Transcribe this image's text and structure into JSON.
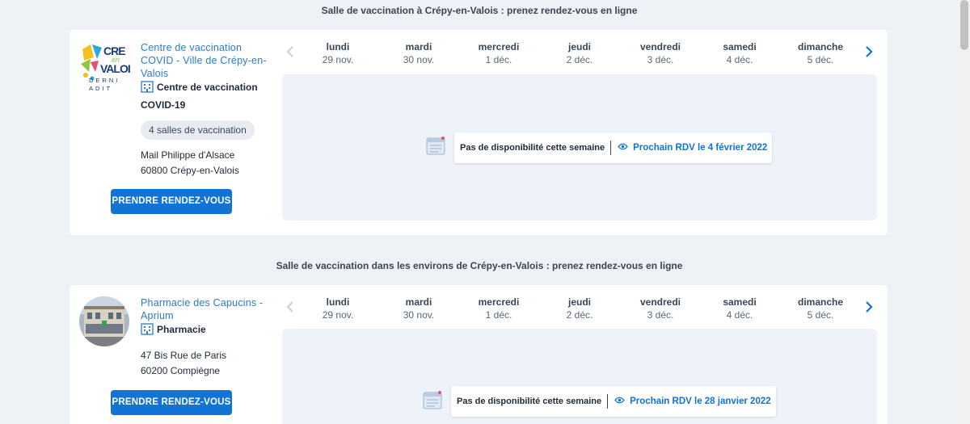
{
  "section1": {
    "title": "Salle de vaccination à Crépy-en-Valois : prenez rendez-vous en ligne"
  },
  "section2": {
    "title": "Salle de vaccination dans les environs de Crépy-en-Valois : prenez rendez-vous en ligne"
  },
  "days": [
    {
      "name": "lundi",
      "date": "29 nov."
    },
    {
      "name": "mardi",
      "date": "30 nov."
    },
    {
      "name": "mercredi",
      "date": "1 déc."
    },
    {
      "name": "jeudi",
      "date": "2 déc."
    },
    {
      "name": "vendredi",
      "date": "3 déc."
    },
    {
      "name": "samedi",
      "date": "4 déc."
    },
    {
      "name": "dimanche",
      "date": "5 déc."
    }
  ],
  "centers": [
    {
      "name": "Centre de vaccination COVID - Ville de Crépy-en-Valois",
      "type": "Centre de vaccination COVID-19",
      "rooms": "4 salles de vaccination",
      "address_line1": "Mail Philippe d'Alsace",
      "address_line2": "60800 Crépy-en-Valois",
      "cta": "PRENDRE RENDEZ-VOUS",
      "no_availability": "Pas de disponibilité cette semaine",
      "next_rdv": "Prochain RDV le 4 février 2022",
      "logo_text": [
        "CRE",
        "en",
        "VALOI",
        "DERNI",
        "ADIT"
      ]
    },
    {
      "name": "Pharmacie des Capucins - Aprium",
      "type": "Pharmacie",
      "address_line1": "47 Bis Rue de Paris",
      "address_line2": "60200 Compiègne",
      "cta": "PRENDRE RENDEZ-VOUS",
      "no_availability": "Pas de disponibilité cette semaine",
      "next_rdv": "Prochain RDV le 28 janvier 2022"
    }
  ],
  "colors": {
    "accent": "#1173d4",
    "link": "#2e7bc4",
    "background": "#eef1f5",
    "panel": "#eef3f9"
  },
  "icons": {
    "prev": "chevron-left-icon",
    "next": "chevron-right-icon",
    "type": "building-icon",
    "eye": "eye-icon",
    "calendar": "calendar-icon"
  }
}
